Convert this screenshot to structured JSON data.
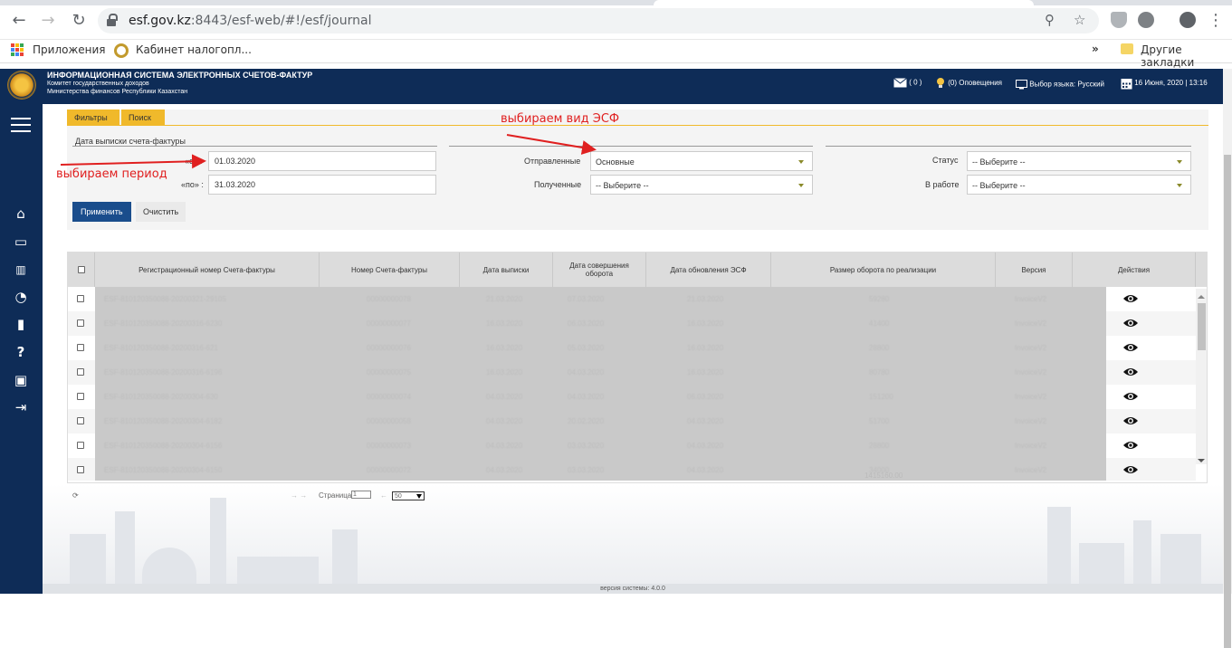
{
  "browser": {
    "url_host": "esf.gov.kz",
    "url_rest": ":8443/esf-web/#!/esf/journal",
    "bookmarks": [
      "Приложения",
      "Кабинет налогопл...",
      "Другие закладки"
    ],
    "more": "»"
  },
  "header": {
    "title": "ИНФОРМАЦИОННАЯ СИСТЕМА ЭЛЕКТРОННЫХ СЧЕТОВ-ФАКТУР",
    "sub1": "Комитет государственных доходов",
    "sub2": "Министерства финансов Республики Казахстан",
    "messages": "( 0 )",
    "notifications": "(0) Оповещения",
    "language": "Выбор языка: Русский",
    "datetime": "16 Июня, 2020 | 13:16"
  },
  "filters": {
    "tab_filters": "Фильтры",
    "tab_search": "Поиск",
    "date_section_label": "Дата выписки счета-фактуры",
    "from_label": "«с» :",
    "to_label": "«по» :",
    "from_value": "01.03.2020",
    "to_value": "31.03.2020",
    "sent_label": "Отправленные",
    "sent_value": "Основные",
    "received_label": "Полученные",
    "received_value": "-- Выберите --",
    "status_label": "Статус",
    "status_value": "-- Выберите --",
    "inwork_label": "В работе",
    "inwork_value": "-- Выберите --",
    "apply": "Применить",
    "clear": "Очистить"
  },
  "annotations": {
    "type_hint": "выбираем вид ЭСФ",
    "period_hint": "выбираем период"
  },
  "table": {
    "headers": [
      "Регистрационный номер Счета-фактуры",
      "Номер Счета-фактуры",
      "Дата выписки",
      "Дата совершения оборота",
      "Дата обновления ЭСФ",
      "Размер оборота по реализации",
      "Версия",
      "Действия"
    ],
    "rows": [
      [
        "ESF-810120350088-20200321-29105",
        "00000000078",
        "21.03.2020",
        "07.03.2020",
        "21.03.2020",
        "59280",
        "InvoiceV2"
      ],
      [
        "ESF-810120350088-20200316-6230",
        "00000000077",
        "16.03.2020",
        "06.03.2020",
        "16.03.2020",
        "41400",
        "InvoiceV2"
      ],
      [
        "ESF-810120350088-20200316-621",
        "00000000076",
        "16.03.2020",
        "05.03.2020",
        "16.03.2020",
        "28800",
        "InvoiceV2"
      ],
      [
        "ESF-810120350088-20200316-6196",
        "00000000075",
        "16.03.2020",
        "04.03.2020",
        "16.03.2020",
        "80780",
        "InvoiceV2"
      ],
      [
        "ESF-810120350088-20200304-630",
        "00000000074",
        "04.03.2020",
        "04.03.2020",
        "06.03.2020",
        "151200",
        "InvoiceV2"
      ],
      [
        "ESF-810120350088-20200304-6182",
        "00000000058",
        "04.03.2020",
        "20.02.2020",
        "04.03.2020",
        "51700",
        "InvoiceV2"
      ],
      [
        "ESF-810120350088-20200304-6156",
        "00000000073",
        "04.03.2020",
        "03.03.2020",
        "04.03.2020",
        "28800",
        "InvoiceV2"
      ],
      [
        "ESF-810120350088-20200304-6150",
        "00000000072",
        "04.03.2020",
        "03.03.2020",
        "04.03.2020",
        "34000",
        "InvoiceV2"
      ]
    ],
    "total": "1415160.00"
  },
  "pager": {
    "page_label": "Страница",
    "page_value": "1",
    "page_size": "50",
    "arrows_next": "→ →",
    "arrows_prev": "←"
  },
  "footer": {
    "version": "версия системы: 4.0.0"
  }
}
